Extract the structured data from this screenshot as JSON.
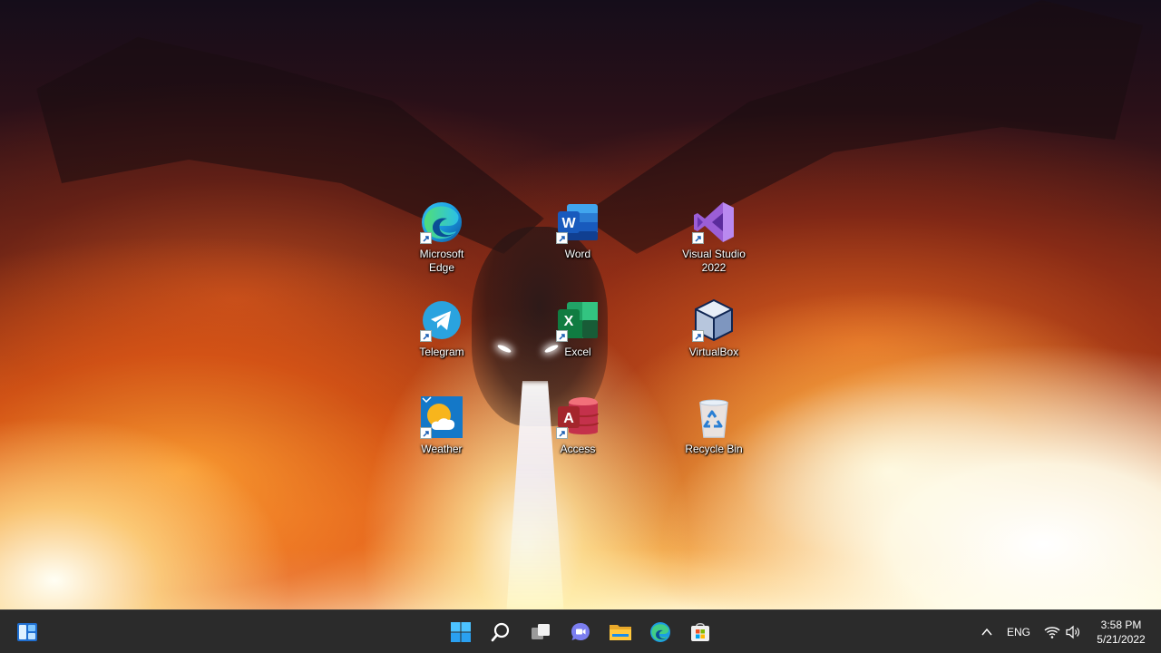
{
  "desktop": {
    "icons": [
      {
        "label": "Microsoft\nEdge",
        "icon": "edge-icon"
      },
      {
        "label": "Word",
        "icon": "word-icon"
      },
      {
        "label": "Visual Studio\n2022",
        "icon": "visual-studio-icon"
      },
      {
        "label": "Telegram",
        "icon": "telegram-icon"
      },
      {
        "label": "Excel",
        "icon": "excel-icon"
      },
      {
        "label": "VirtualBox",
        "icon": "virtualbox-icon"
      },
      {
        "label": "Weather",
        "icon": "weather-icon"
      },
      {
        "label": "Access",
        "icon": "access-icon"
      },
      {
        "label": "Recycle Bin",
        "icon": "recycle-bin-icon"
      }
    ]
  },
  "taskbar": {
    "widgets_icon": "widgets-icon",
    "center_buttons": [
      "start-icon",
      "search-icon",
      "task-view-icon",
      "chat-icon",
      "file-explorer-icon",
      "edge-icon",
      "store-icon"
    ],
    "tray": {
      "overflow_icon": "chevron-up-icon",
      "language": "ENG",
      "wifi_icon": "wifi-icon",
      "volume_icon": "volume-icon"
    },
    "clock": {
      "time": "3:58 PM",
      "date": "5/21/2022"
    }
  },
  "colors": {
    "taskbar": "#2b2b2b",
    "accent": "#0078d4"
  }
}
